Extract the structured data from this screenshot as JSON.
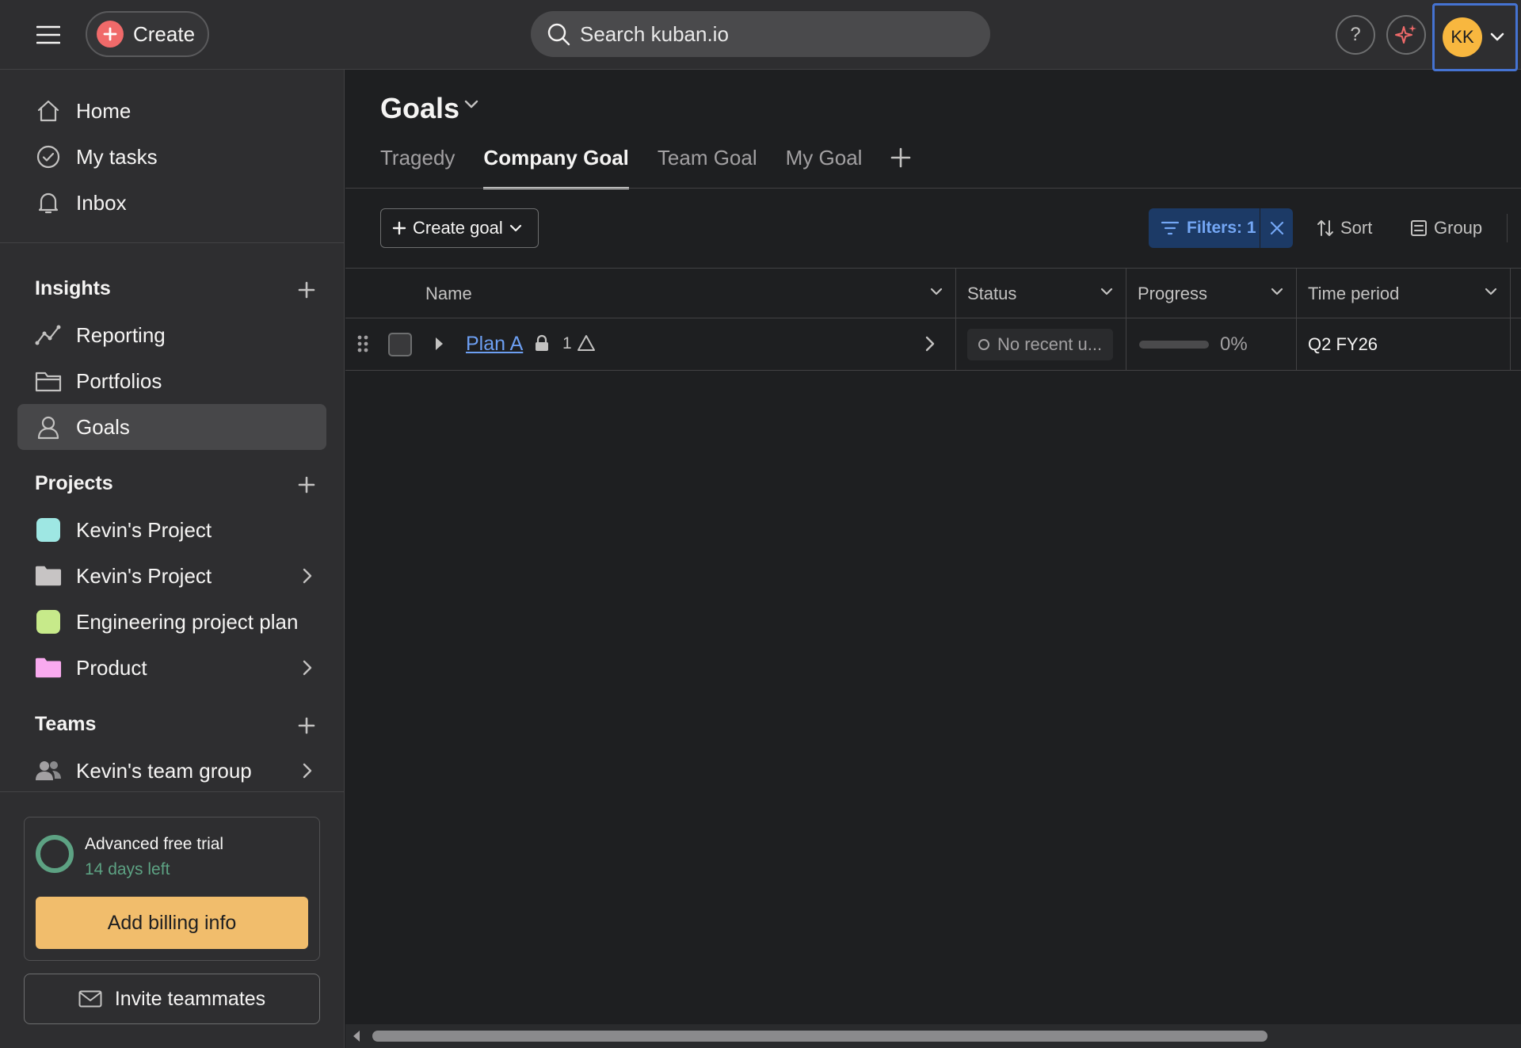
{
  "topbar": {
    "create_label": "Create",
    "search_placeholder": "Search kuban.io",
    "help_label": "?",
    "avatar_initials": "KK"
  },
  "sidebar": {
    "nav": [
      {
        "label": "Home",
        "icon": "home-icon"
      },
      {
        "label": "My tasks",
        "icon": "check-circle-icon"
      },
      {
        "label": "Inbox",
        "icon": "bell-icon"
      }
    ],
    "insights": {
      "title": "Insights",
      "items": [
        {
          "label": "Reporting",
          "icon": "chart-line-icon"
        },
        {
          "label": "Portfolios",
          "icon": "folder-icon"
        },
        {
          "label": "Goals",
          "icon": "person-icon",
          "active": true
        }
      ]
    },
    "projects": {
      "title": "Projects",
      "items": [
        {
          "label": "Kevin's Project",
          "color": "#9ee7e3"
        },
        {
          "label": "Kevin's Project",
          "color": "#c7c4c4"
        },
        {
          "label": "Engineering project plan",
          "color": "#c7ea8a"
        },
        {
          "label": "Product",
          "color": "#f9aaef"
        }
      ]
    },
    "teams": {
      "title": "Teams",
      "items": [
        {
          "label": "Kevin's team group",
          "icon": "team-icon"
        }
      ]
    },
    "trial": {
      "title": "Advanced free trial",
      "days_left": "14 days left",
      "billing_label": "Add billing info"
    },
    "invite_label": "Invite teammates"
  },
  "main": {
    "title": "Goals",
    "tabs": [
      {
        "label": "Tragedy"
      },
      {
        "label": "Company Goal",
        "active": true
      },
      {
        "label": "Team Goal"
      },
      {
        "label": "My Goal"
      }
    ],
    "toolbar": {
      "create_goal_label": "Create goal",
      "filters_label": "Filters: 1",
      "sort_label": "Sort",
      "group_label": "Group"
    },
    "table": {
      "columns": [
        "Name",
        "Status",
        "Progress",
        "Time period"
      ],
      "rows": [
        {
          "name": "Plan A",
          "subgoal_count": "1",
          "status": "No recent u...",
          "progress_label": "0%",
          "progress_value": 0,
          "time_period": "Q2 FY26"
        }
      ]
    }
  },
  "colors": {
    "accent_red": "#f06a6a",
    "accent_blue": "#4573d2",
    "trial_green": "#5da283",
    "billing_orange": "#f1bd6c",
    "avatar_yellow": "#f8b73f"
  }
}
